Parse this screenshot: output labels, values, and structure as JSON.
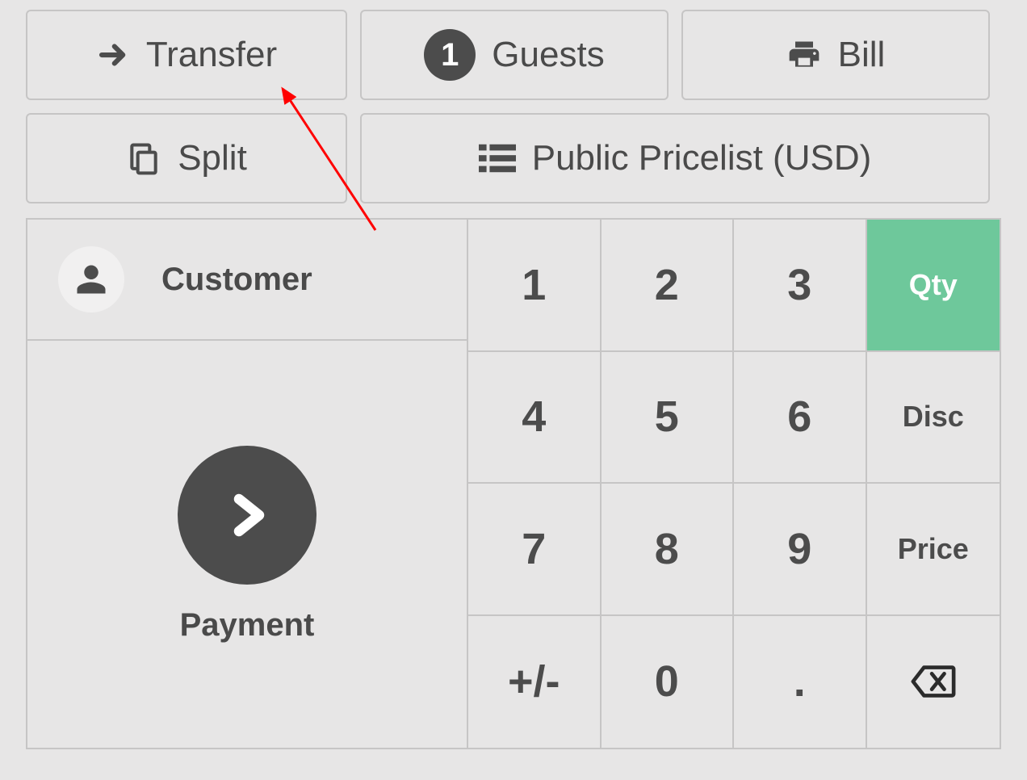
{
  "actions": {
    "transfer": "Transfer",
    "guests_count": "1",
    "guests": "Guests",
    "bill": "Bill",
    "split": "Split",
    "pricelist": "Public Pricelist (USD)"
  },
  "left": {
    "customer": "Customer",
    "payment": "Payment"
  },
  "keypad": {
    "k1": "1",
    "k2": "2",
    "k3": "3",
    "qty": "Qty",
    "k4": "4",
    "k5": "5",
    "k6": "6",
    "disc": "Disc",
    "k7": "7",
    "k8": "8",
    "k9": "9",
    "price": "Price",
    "pm": "+/-",
    "k0": "0",
    "dot": "."
  }
}
